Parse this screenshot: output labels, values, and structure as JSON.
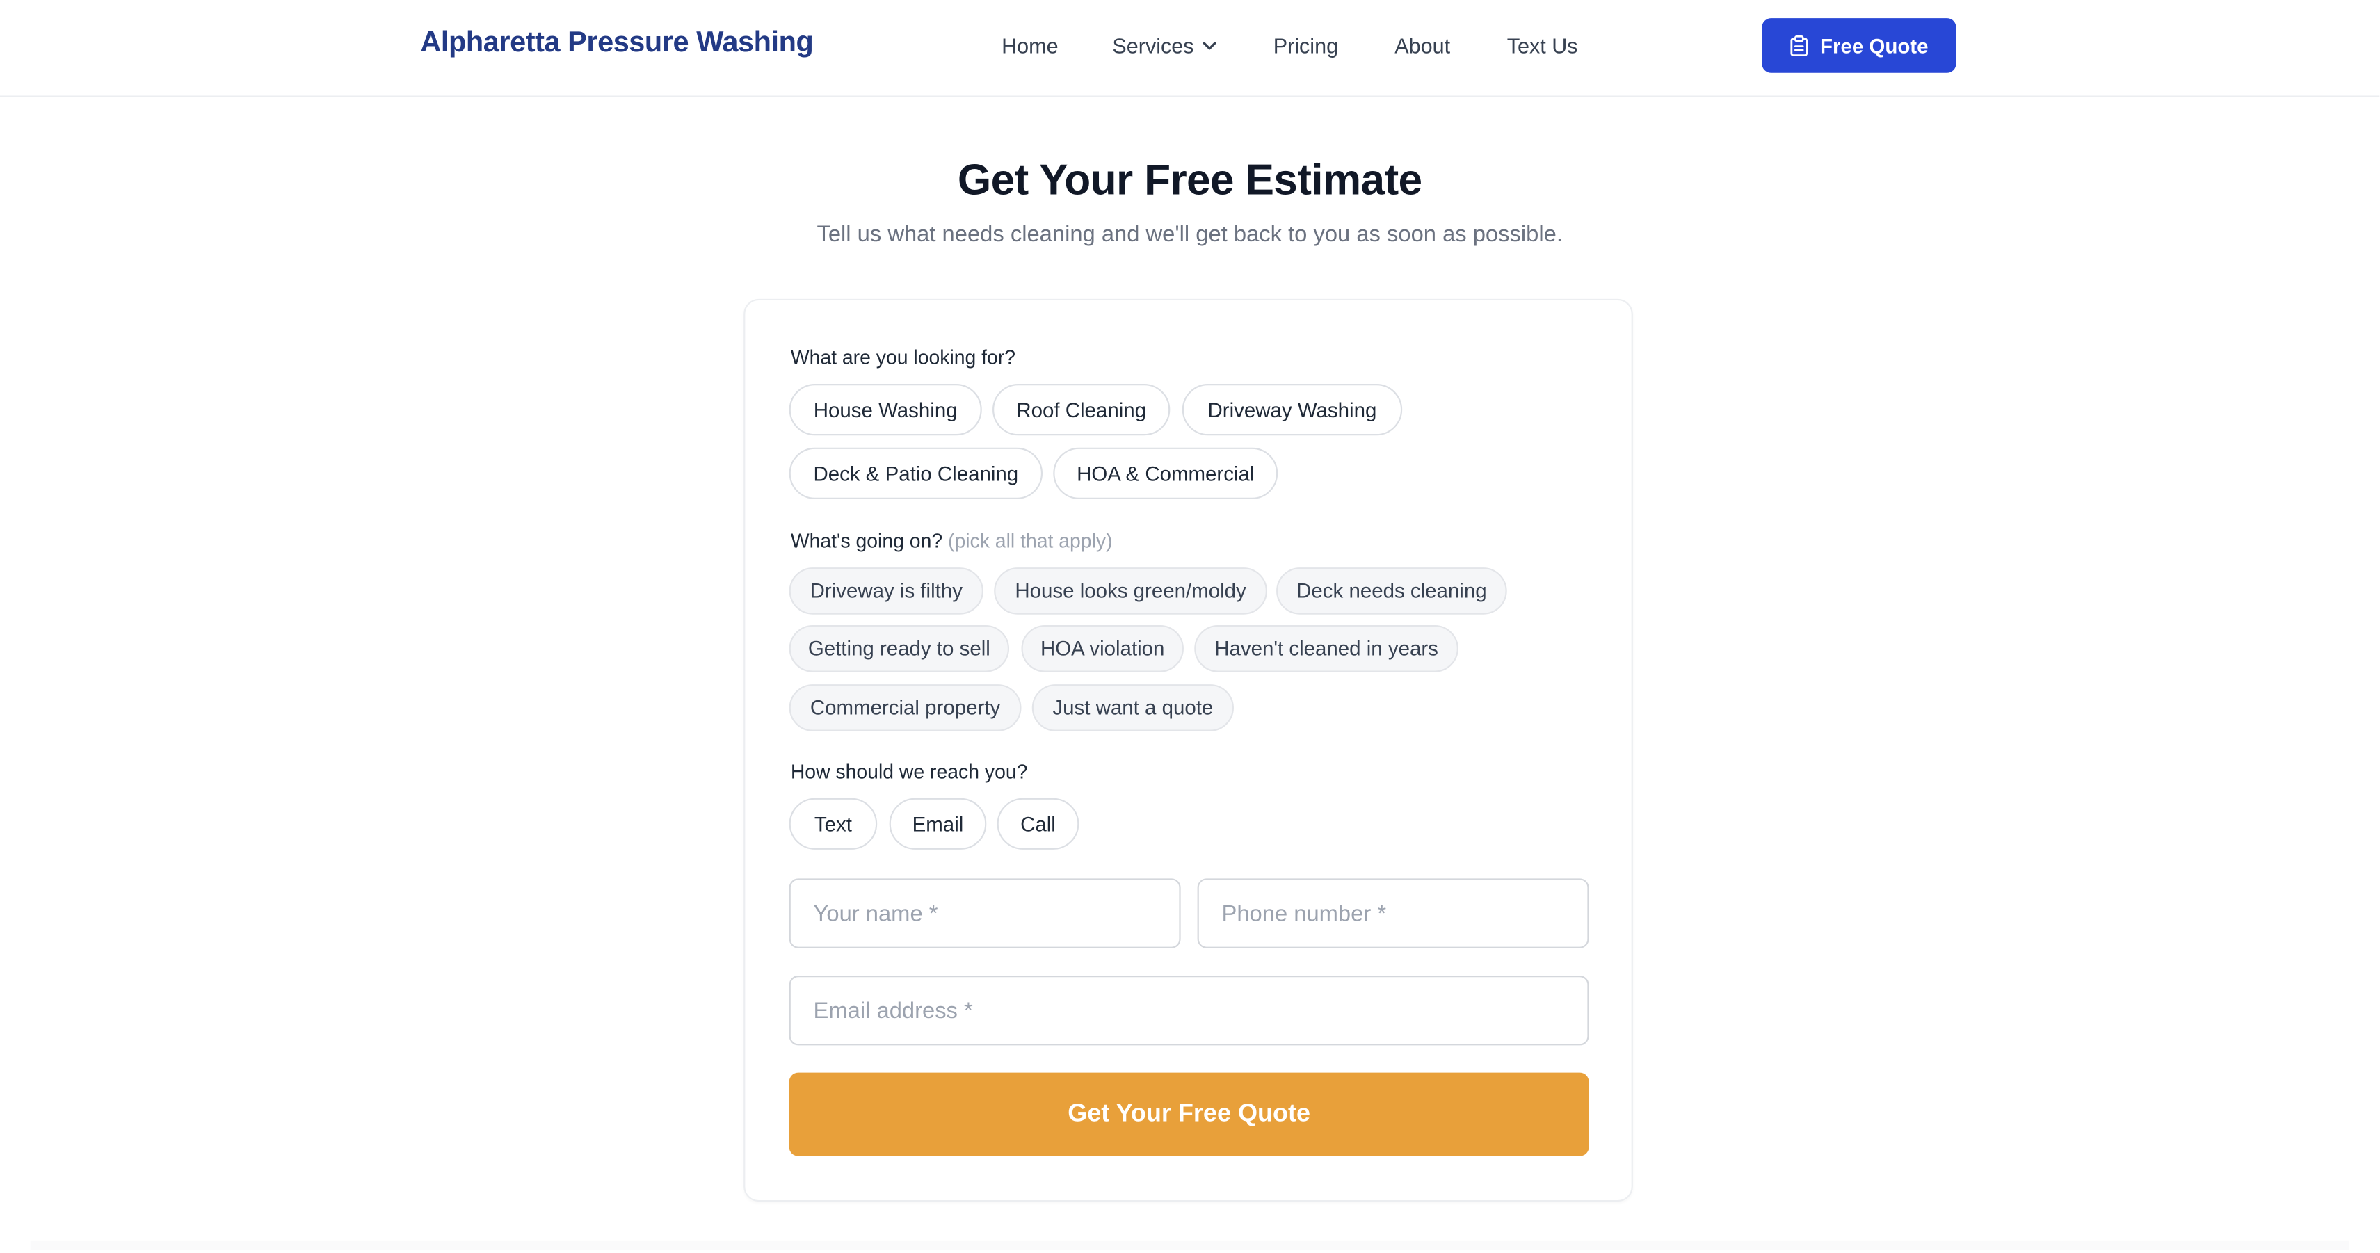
{
  "header": {
    "brand": "Alpharetta Pressure Washing",
    "nav": {
      "home": "Home",
      "services": "Services",
      "pricing": "Pricing",
      "about": "About",
      "text_us": "Text Us"
    },
    "cta_label": "Free Quote",
    "cta_icon": "clipboard-icon",
    "services_icon": "chevron-down-icon"
  },
  "hero": {
    "title": "Get Your Free Estimate",
    "subtitle": "Tell us what needs cleaning and we'll get back to you as soon as possible."
  },
  "form": {
    "service_question": "What are you looking for?",
    "services": [
      "House Washing",
      "Roof Cleaning",
      "Driveway Washing",
      "Deck & Patio Cleaning",
      "HOA & Commercial"
    ],
    "situation_question": "What's going on?",
    "situation_hint": "(pick all that apply)",
    "situations": [
      "Driveway is filthy",
      "House looks green/moldy",
      "Deck needs cleaning",
      "Getting ready to sell",
      "HOA violation",
      "Haven't cleaned in years",
      "Commercial property",
      "Just want a quote"
    ],
    "contact_question": "How should we reach you?",
    "contact_methods": [
      "Text",
      "Email",
      "Call"
    ],
    "name_placeholder": "Your name *",
    "phone_placeholder": "Phone number *",
    "email_placeholder": "Email address *",
    "submit_label": "Get Your Free Quote"
  },
  "colors": {
    "brand": "#233a85",
    "primary_button": "#2847d6",
    "submit_button": "#e8a03a"
  }
}
